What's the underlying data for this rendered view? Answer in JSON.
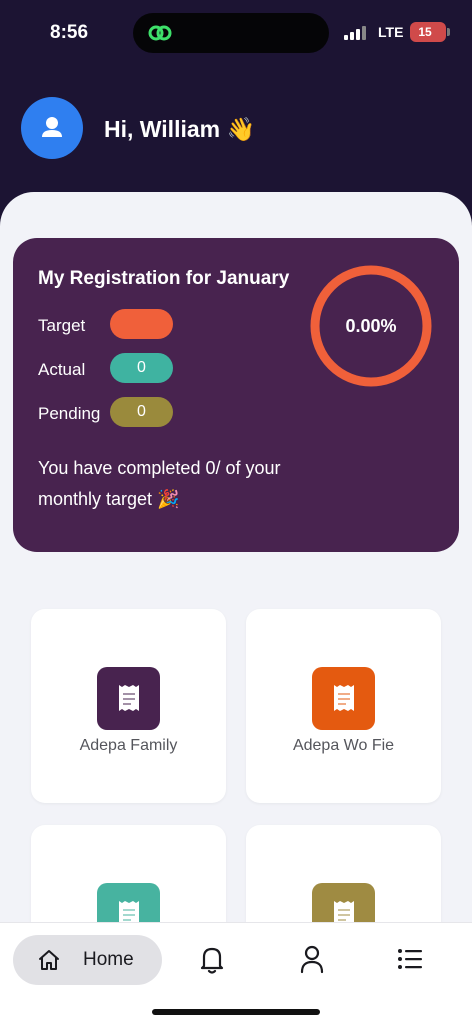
{
  "status_bar": {
    "time": "8:56",
    "network": "LTE",
    "battery": "15"
  },
  "header": {
    "greeting": "Hi, William 👋"
  },
  "registration": {
    "title": "My Registration for January",
    "target_label": "Target",
    "target_value": "",
    "actual_label": "Actual",
    "actual_value": "0",
    "pending_label": "Pending",
    "pending_value": "0",
    "progress_text": "0.00%",
    "progress_fraction": 0.0,
    "message": "You have completed 0/ of your monthly target 🎉"
  },
  "tiles": [
    {
      "label": "Adepa Family",
      "icon": "receipt-icon",
      "color": "#48234f"
    },
    {
      "label": "Adepa Wo Fie",
      "icon": "receipt-icon",
      "color": "#e45a10"
    },
    {
      "label": "",
      "icon": "receipt-icon",
      "color": "#47b3a0"
    },
    {
      "label": "",
      "icon": "receipt-icon",
      "color": "#9f8b42"
    }
  ],
  "nav": {
    "home_label": "Home",
    "items": [
      "home-icon",
      "bell-icon",
      "profile-icon",
      "list-icon"
    ]
  },
  "colors": {
    "header_bg": "#1c1433",
    "card_bg": "#48234f",
    "target_pill": "#f0603a",
    "actual_pill": "#3fb3a1",
    "pending_pill": "#9a8a3c",
    "ring": "#f0603a",
    "avatar": "#2f7ff0"
  }
}
